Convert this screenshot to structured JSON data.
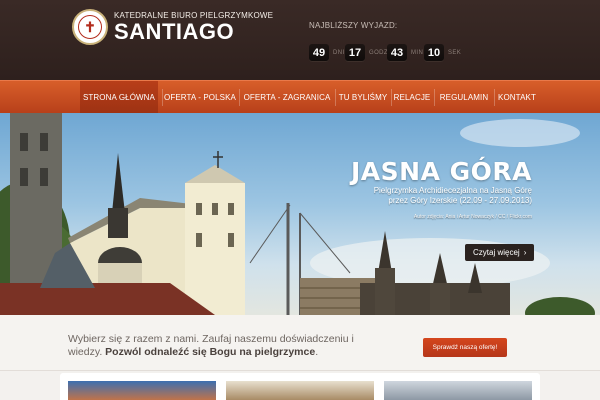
{
  "brand": {
    "subtitle": "KATEDRALNE BIURO PIELGRZYMKOWE",
    "name": "SANTIAGO"
  },
  "countdown": {
    "label": "NAJBLIŻSZY WYJAZD:",
    "items": [
      {
        "value": "49",
        "unit": "DNI"
      },
      {
        "value": "17",
        "unit": "GODZ"
      },
      {
        "value": "43",
        "unit": "MIN"
      },
      {
        "value": "10",
        "unit": "SEK"
      }
    ]
  },
  "nav": {
    "items": [
      {
        "label": "STRONA GŁÓWNA",
        "active": true
      },
      {
        "label": "OFERTA - POLSKA",
        "active": false
      },
      {
        "label": "OFERTA - ZAGRANICA",
        "active": false
      },
      {
        "label": "TU BYLIŚMY",
        "active": false
      },
      {
        "label": "RELACJE",
        "active": false
      },
      {
        "label": "REGULAMIN",
        "active": false
      },
      {
        "label": "KONTAKT",
        "active": false
      }
    ]
  },
  "hero": {
    "title": "JASNA GÓRA",
    "description": "Pielgrzymka Archidiecezjalna na Jasną Górę przez Góry Izerskie (22.09 - 27.09.2013)",
    "credit": "Autor zdjęcia: Ania i Artur Nowaczyk / CC / Flickr.com",
    "button": "Czytaj więcej"
  },
  "cta": {
    "text_normal": "Wybierz się z razem z nami. Zaufaj naszemu doświadczeniu i wiedzy. ",
    "text_bold": "Pozwól odnaleźć się Bogu na pielgrzymce",
    "text_end": ".",
    "button": "Sprawdź naszą ofertę!"
  },
  "colors": {
    "header_bg": "#2e201d",
    "nav_accent": "#c84a1e",
    "cta_button": "#c23d1b"
  }
}
